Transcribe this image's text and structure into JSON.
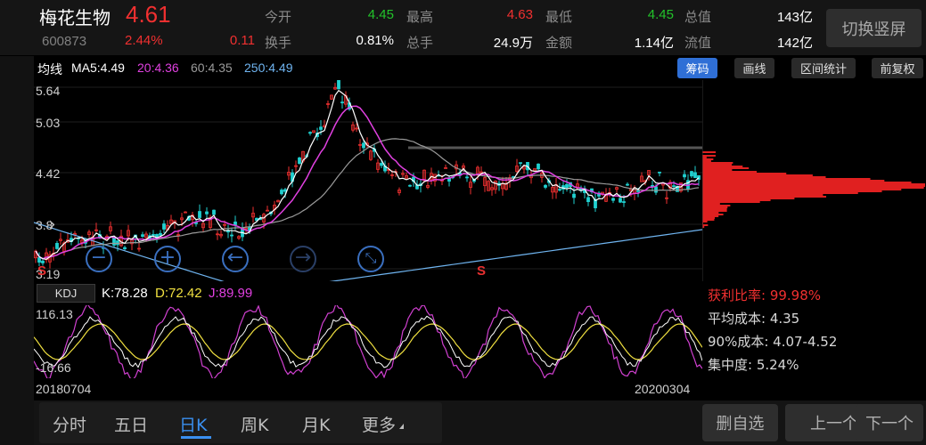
{
  "header": {
    "stock_name": "梅花生物",
    "price": "4.61",
    "code": "600873",
    "change_pct": "2.44%",
    "change_amt": "0.11",
    "quotes": [
      {
        "label": "今开",
        "value": "4.45",
        "color": "#22c32a"
      },
      {
        "label": "最高",
        "value": "4.63",
        "color": "#f03030"
      },
      {
        "label": "最低",
        "value": "4.45",
        "color": "#22c32a"
      },
      {
        "label": "总值",
        "value": "143亿",
        "color": "#ffffff"
      },
      {
        "label": "换手",
        "value": "0.81%",
        "color": "#ffffff"
      },
      {
        "label": "总手",
        "value": "24.9万",
        "color": "#ffffff"
      },
      {
        "label": "金额",
        "value": "1.14亿",
        "color": "#ffffff"
      },
      {
        "label": "流值",
        "value": "142亿",
        "color": "#ffffff"
      }
    ],
    "switch_button": "切换竖屏"
  },
  "ma_bar": {
    "title": "均线",
    "items": [
      {
        "text": "MA5:4.49",
        "color": "#ffffff"
      },
      {
        "text": "20:4.36",
        "color": "#e040e0"
      },
      {
        "text": "60:4.35",
        "color": "#9a9a9a"
      },
      {
        "text": "250:4.49",
        "color": "#6fb4f0"
      }
    ],
    "buttons": [
      "筹码",
      "画线",
      "区间统计",
      "前复权"
    ],
    "active_button": "筹码"
  },
  "price_axis": [
    "5.64",
    "5.03",
    "4.42",
    "3.8",
    "3.19"
  ],
  "controls": [
    "zoom-out-icon",
    "zoom-in-icon",
    "arrow-left-icon",
    "arrow-right-icon",
    "collapse-icon"
  ],
  "marks": [
    "S",
    "S"
  ],
  "kdj": {
    "button": "KDJ",
    "k": "K:78.28",
    "d": "D:72.42",
    "j": "J:89.99",
    "axis_top": "116.13",
    "axis_bottom": "-16.66"
  },
  "cost": {
    "profit_ratio": "获利比率: 99.98%",
    "avg_cost": "平均成本: 4.35",
    "cost_90": "90%成本: 4.07-4.52",
    "concentration": "集中度: 5.24%"
  },
  "dates": {
    "start": "20180704",
    "end": "20200304"
  },
  "tabs": [
    "分时",
    "五日",
    "日K",
    "周K",
    "月K",
    "更多"
  ],
  "active_tab": "日K",
  "actions": [
    "删自选",
    "上一个",
    "下一个"
  ],
  "colors": {
    "up": "#f03030",
    "down": "#22c32a",
    "accent": "#2f6fd6",
    "ma5": "#ffffff",
    "ma20": "#e040e0",
    "ma60": "#9a9a9a",
    "ma250": "#6fb4f0"
  }
}
